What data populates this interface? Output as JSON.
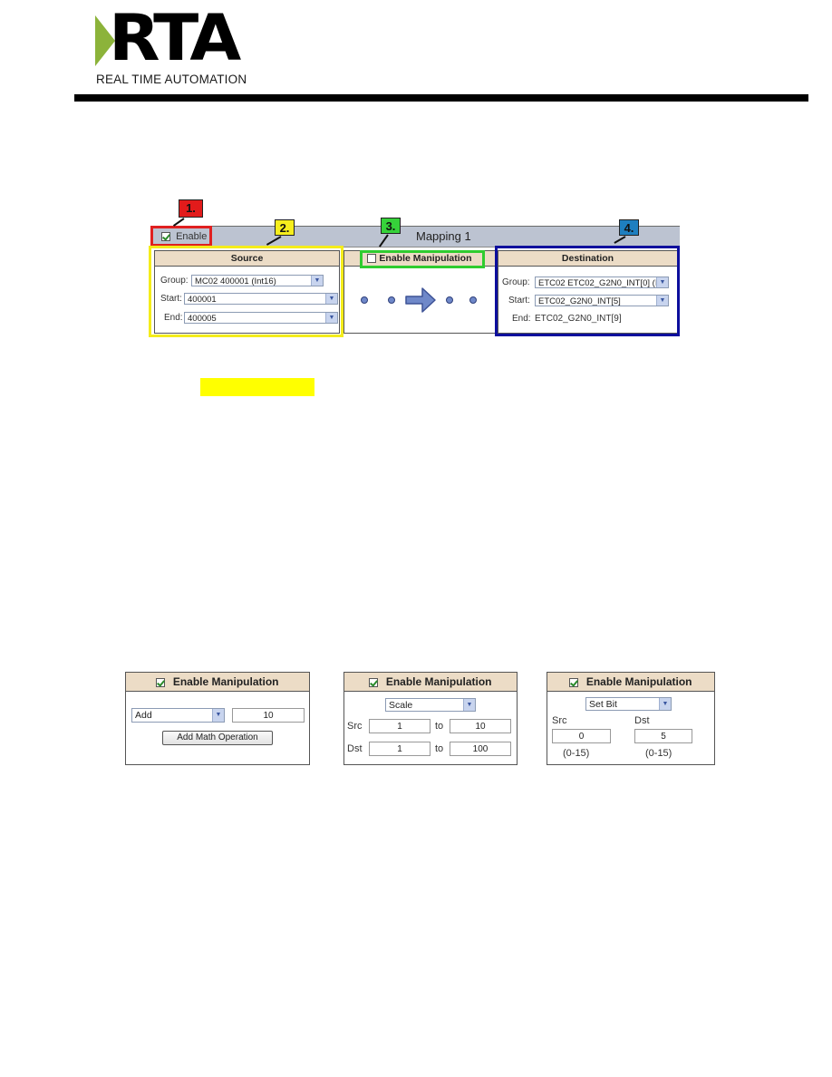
{
  "header": {
    "logo_letters": "RTA",
    "logo_subtitle": "REAL TIME AUTOMATION",
    "logo_accent": "#8cb33a"
  },
  "mapping": {
    "title": "Mapping 1",
    "enable_label": "Enable",
    "enable_checked": true,
    "source": {
      "heading": "Source",
      "group_label": "Group:",
      "group_value": "MC02 400001 (Int16)",
      "start_label": "Start:",
      "start_value": "400001",
      "end_label": "End:",
      "end_value": "400005"
    },
    "manipulation": {
      "label": "Enable Manipulation",
      "checked": false
    },
    "destination": {
      "heading": "Destination",
      "group_label": "Group:",
      "group_value": "ETC02 ETC02_G2N0_INT[0] (I",
      "start_label": "Start:",
      "start_value": "ETC02_G2N0_INT[5]",
      "end_label": "End:",
      "end_value": "ETC02_G2N0_INT[9]"
    },
    "callouts": [
      {
        "label": "1.",
        "color": "#e21b1b"
      },
      {
        "label": "2.",
        "color": "#f6ee1d"
      },
      {
        "label": "3.",
        "color": "#36d23a"
      },
      {
        "label": "4.",
        "color": "#1e7fc0"
      }
    ]
  },
  "examples": {
    "heading": "Enable Manipulation",
    "add": {
      "operation": "Add",
      "value": "10",
      "button": "Add Math Operation"
    },
    "scale": {
      "operation": "Scale",
      "src_label": "Src",
      "dst_label": "Dst",
      "to_label": "to",
      "src_from": "1",
      "src_to": "10",
      "dst_from": "1",
      "dst_to": "100"
    },
    "setbit": {
      "operation": "Set Bit",
      "src_label": "Src",
      "dst_label": "Dst",
      "src_value": "0",
      "dst_value": "5",
      "src_range": "(0-15)",
      "dst_range": "(0-15)"
    }
  }
}
